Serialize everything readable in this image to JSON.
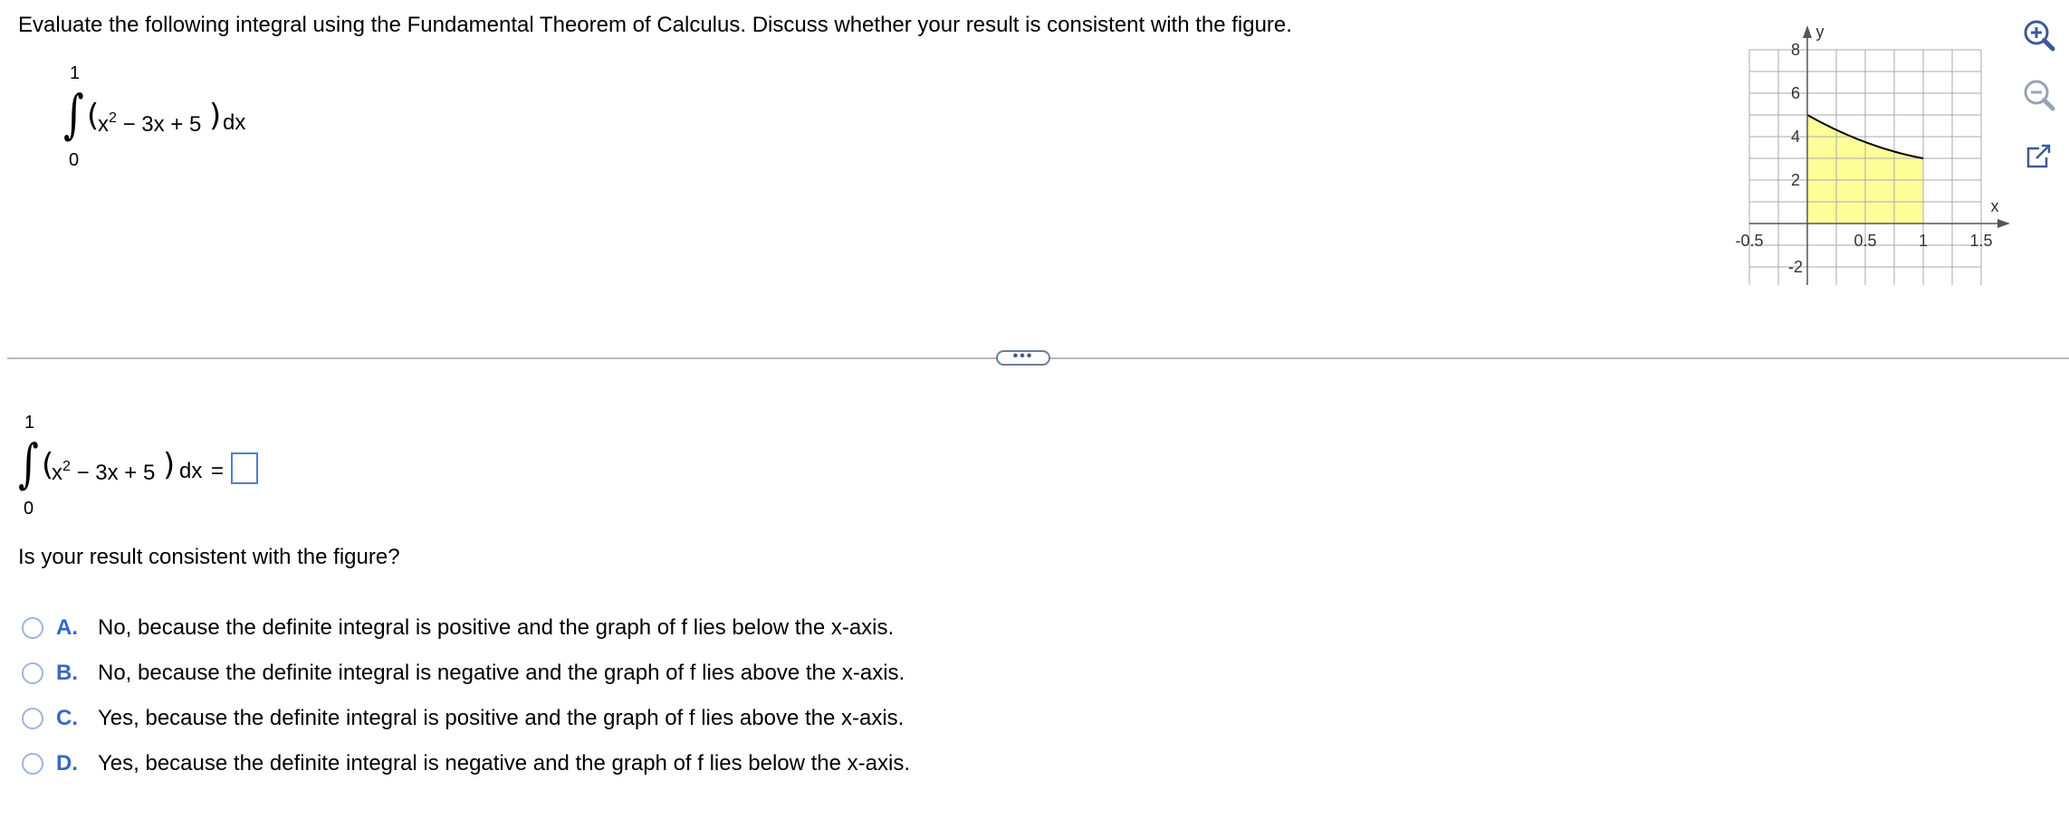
{
  "question": {
    "prompt": "Evaluate the following integral using the Fundamental Theorem of Calculus. Discuss whether your result is consistent with the figure.",
    "integral": {
      "upper": "1",
      "lower": "0",
      "integrand": "x",
      "exponent": "2",
      "rest": " − 3x + 5",
      "dx": "dx"
    }
  },
  "graph": {
    "y_axis_label": "y",
    "x_axis_label": "x",
    "x_ticks": [
      "-0.5",
      "0.5",
      "1",
      "1.5"
    ],
    "y_ticks": [
      "8",
      "6",
      "4",
      "2",
      "-2"
    ],
    "fill_color": "#ffff99",
    "xlim": [
      -0.5,
      1.5
    ],
    "ylim": [
      -3,
      8
    ],
    "curve": {
      "function": "x^2 - 3x + 5",
      "from": 0,
      "to": 1
    }
  },
  "more_button_label": "•••",
  "answer": {
    "equals": "=",
    "box_value": ""
  },
  "consistency_question": "Is your result consistent with the figure?",
  "options": [
    {
      "letter": "A.",
      "text": "No, because the definite integral is positive and the graph of f lies below the x-axis."
    },
    {
      "letter": "B.",
      "text": "No, because the definite integral is negative and the graph of f lies above the x-axis."
    },
    {
      "letter": "C.",
      "text": "Yes, because the definite integral is positive and the graph of f lies above the x-axis."
    },
    {
      "letter": "D.",
      "text": "Yes, because the definite integral is negative and the graph of f lies below the x-axis."
    }
  ],
  "tools": {
    "zoom_in": "zoom-in-icon",
    "zoom_out": "zoom-out-icon",
    "popout": "popout-icon"
  },
  "colors": {
    "accent": "#3569c5",
    "radio_border": "#9cb4e0",
    "answer_box_border": "#4a7fd6"
  }
}
